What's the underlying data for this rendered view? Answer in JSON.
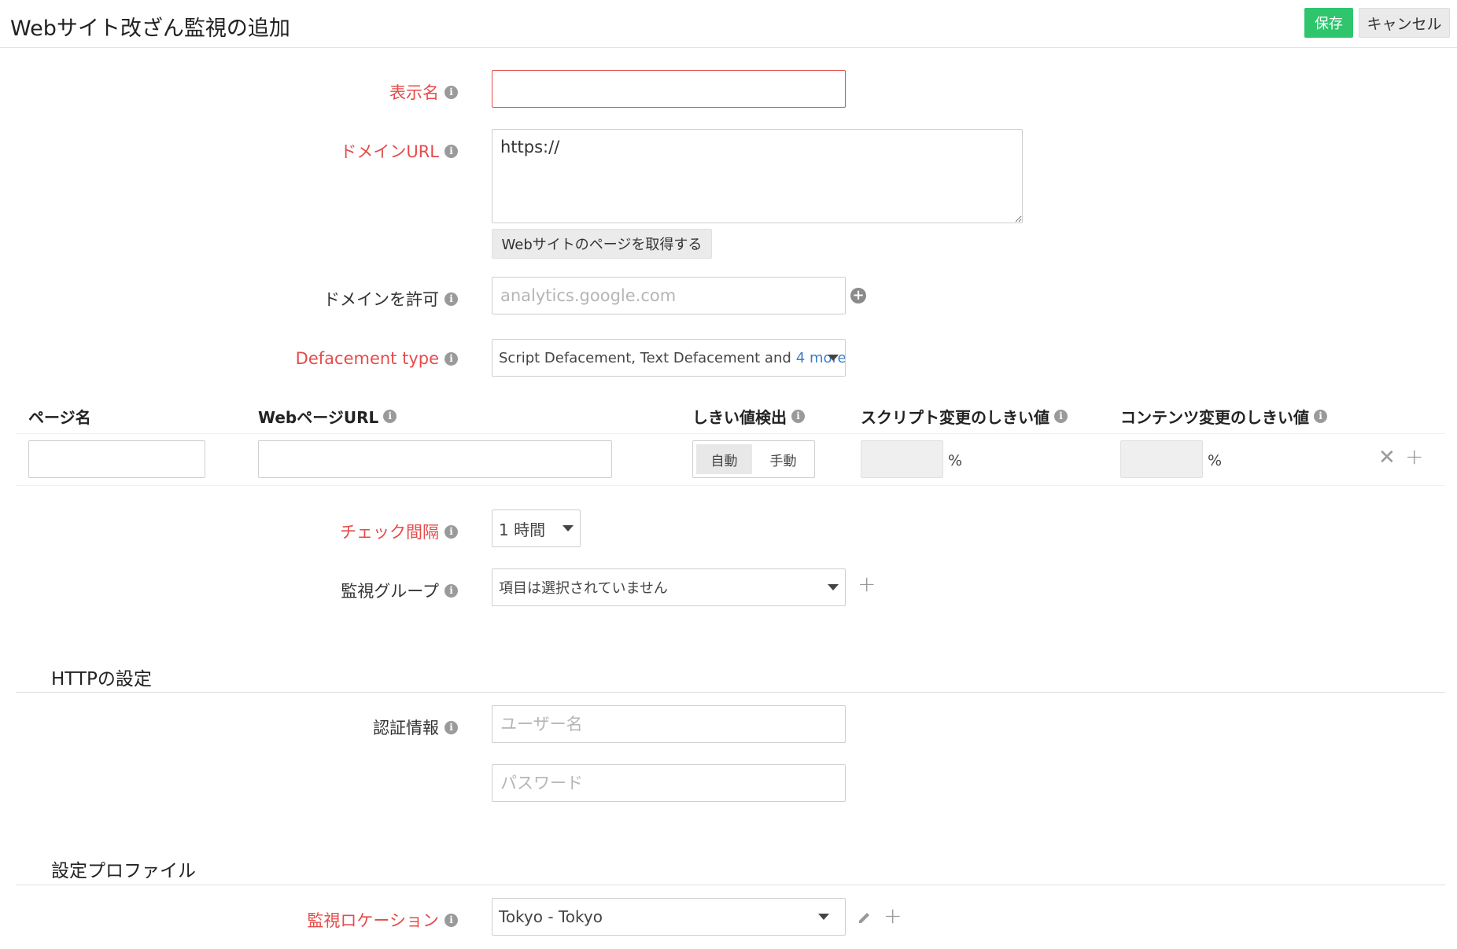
{
  "header": {
    "title": "Webサイト改ざん監視の追加",
    "save_label": "保存",
    "cancel_label": "キャンセル"
  },
  "form": {
    "display_name": {
      "label": "表示名",
      "value": "",
      "placeholder": ""
    },
    "domain_url": {
      "label": "ドメインURL",
      "value": "https://"
    },
    "fetch_button": "Webサイトのページを取得する",
    "allow_domain": {
      "label": "ドメインを許可",
      "placeholder": "analytics.google.com"
    },
    "defacement_type": {
      "label": "Defacement type",
      "selected": "Script Defacement, Text Defacement and",
      "more": "4 more"
    }
  },
  "pages_table": {
    "headers": {
      "page_name": "ページ名",
      "webpage_url": "WebページURL",
      "threshold_detect": "しきい値検出",
      "script_threshold": "スクリプト変更のしきい値",
      "content_threshold": "コンテンツ変更のしきい値"
    },
    "row": {
      "toggle_auto": "自動",
      "toggle_manual": "手動",
      "pct": "%"
    }
  },
  "check_interval": {
    "label": "チェック間隔",
    "selected": "1 時間"
  },
  "monitor_group": {
    "label": "監視グループ",
    "selected": "項目は選択されていません"
  },
  "http_section": {
    "title": "HTTPの設定",
    "auth_label": "認証情報",
    "username_placeholder": "ユーザー名",
    "password_placeholder": "パスワード"
  },
  "profile_section": {
    "title": "設定プロファイル",
    "location_label": "監視ロケーション",
    "location_selected": "Tokyo - Tokyo"
  },
  "colors": {
    "accent_green": "#2ec56d",
    "required_red": "#e54b4b",
    "link_blue": "#3a7ec8"
  }
}
